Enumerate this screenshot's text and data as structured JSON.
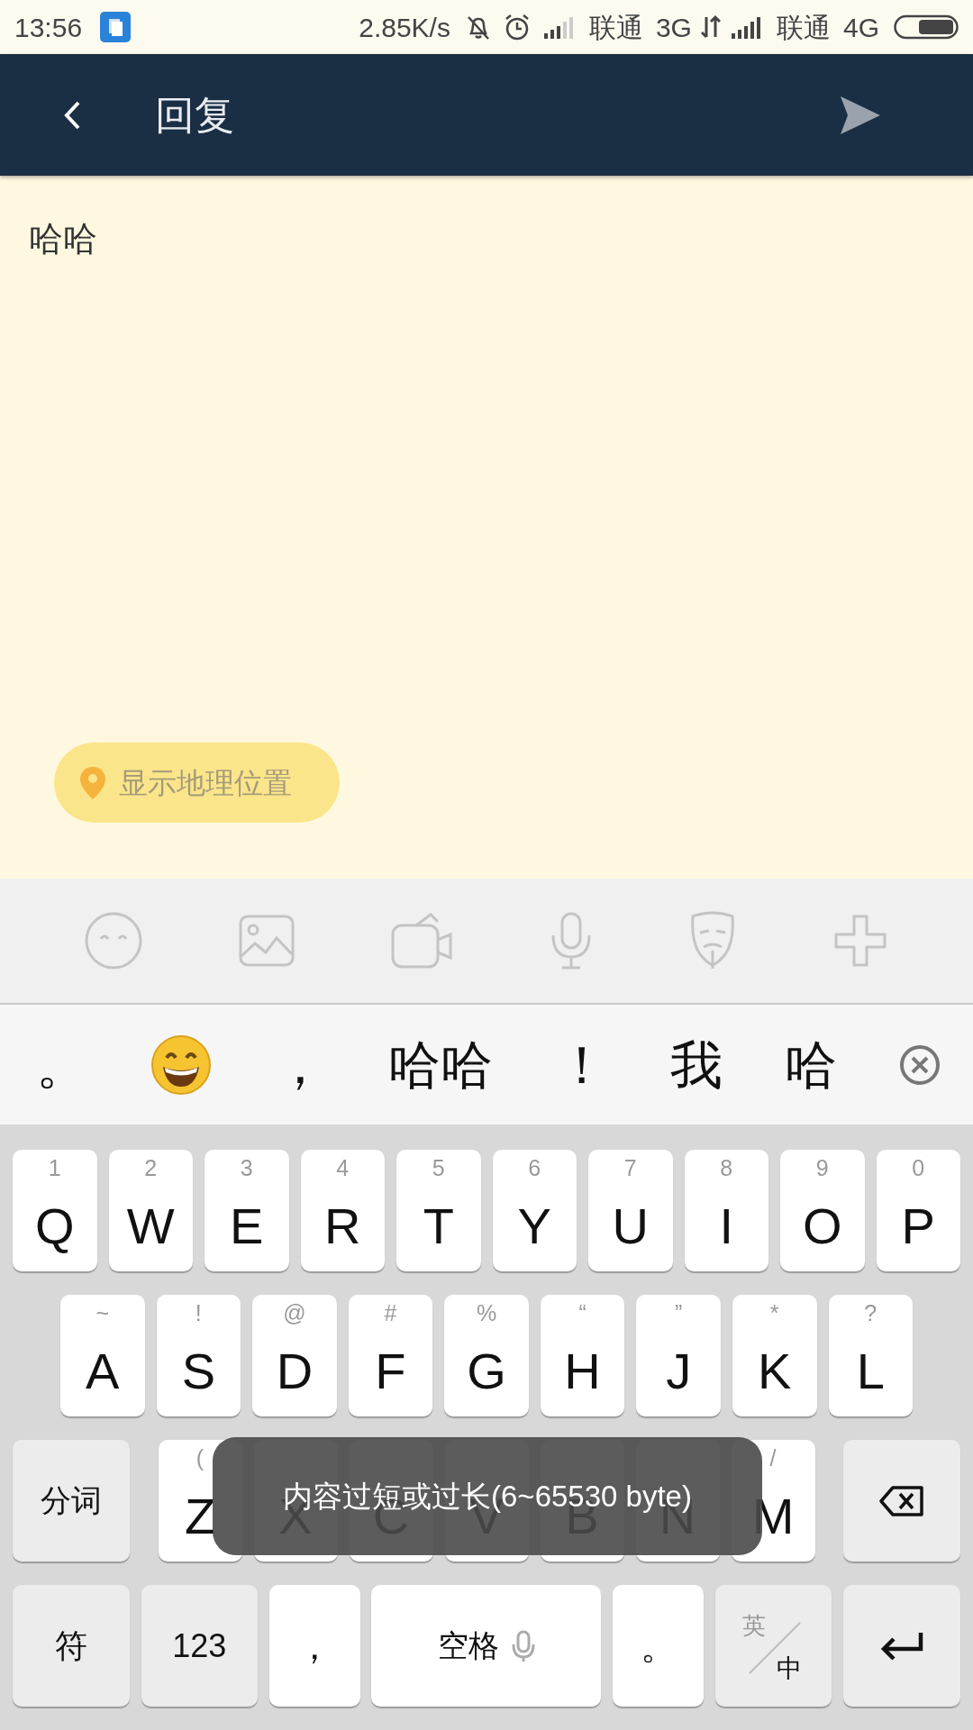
{
  "status_bar": {
    "time": "13:56",
    "speed": "2.85K/s",
    "carrier_1": "联通",
    "network_1": "3G",
    "carrier_2": "联通",
    "network_2": "4G"
  },
  "header": {
    "title": "回复"
  },
  "message": {
    "text": "哈哈"
  },
  "location_button": {
    "label": "显示地理位置"
  },
  "candidates": [
    {
      "kind": "text",
      "text": "。"
    },
    {
      "kind": "emoji"
    },
    {
      "kind": "text",
      "text": "，"
    },
    {
      "kind": "text",
      "text": "哈哈"
    },
    {
      "kind": "text",
      "text": "！"
    },
    {
      "kind": "text",
      "text": "我"
    },
    {
      "kind": "text",
      "text": "哈"
    }
  ],
  "keyboard": {
    "row_1": [
      {
        "label": "Q",
        "hint": "1"
      },
      {
        "label": "W",
        "hint": "2"
      },
      {
        "label": "E",
        "hint": "3"
      },
      {
        "label": "R",
        "hint": "4"
      },
      {
        "label": "T",
        "hint": "5"
      },
      {
        "label": "Y",
        "hint": "6"
      },
      {
        "label": "U",
        "hint": "7"
      },
      {
        "label": "I",
        "hint": "8"
      },
      {
        "label": "O",
        "hint": "9"
      },
      {
        "label": "P",
        "hint": "0"
      }
    ],
    "row_2": [
      {
        "label": "A",
        "hint": "~"
      },
      {
        "label": "S",
        "hint": "!"
      },
      {
        "label": "D",
        "hint": "@"
      },
      {
        "label": "F",
        "hint": "#"
      },
      {
        "label": "G",
        "hint": "%"
      },
      {
        "label": "H",
        "hint": "“"
      },
      {
        "label": "J",
        "hint": "”"
      },
      {
        "label": "K",
        "hint": "*"
      },
      {
        "label": "L",
        "hint": "?"
      }
    ],
    "row_3_left": {
      "label": "分词"
    },
    "row_3": [
      {
        "label": "Z",
        "hint": "("
      },
      {
        "label": "X"
      },
      {
        "label": "C"
      },
      {
        "label": "V"
      },
      {
        "label": "B"
      },
      {
        "label": "N"
      },
      {
        "label": "M",
        "hint": "/"
      }
    ],
    "row_4": [
      {
        "kind": "special",
        "label": "符"
      },
      {
        "kind": "special",
        "label": "123"
      },
      {
        "kind": "plain",
        "label": "，"
      },
      {
        "kind": "space",
        "label": "空格"
      },
      {
        "kind": "plain",
        "label": "。"
      },
      {
        "kind": "lang",
        "top": "英",
        "bottom": "中"
      },
      {
        "kind": "enter"
      }
    ]
  },
  "toast": {
    "text": "内容过短或过长(6~65530 byte)"
  }
}
